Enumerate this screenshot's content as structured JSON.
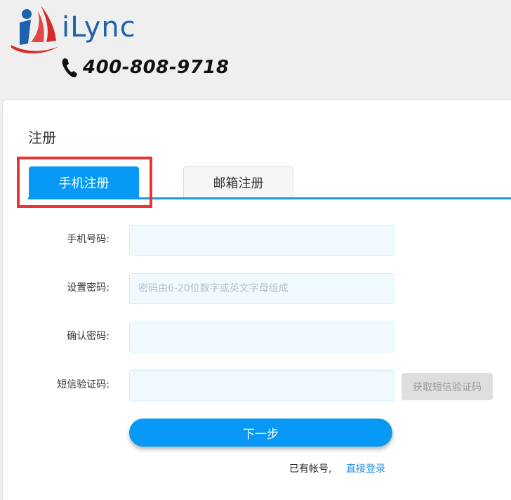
{
  "header": {
    "brand": "iLync",
    "phone": "400-808-9718"
  },
  "page": {
    "title": "注册"
  },
  "tabs": [
    {
      "label": "手机注册",
      "active": true
    },
    {
      "label": "邮箱注册",
      "active": false
    }
  ],
  "form": {
    "phone_label": "手机号码:",
    "password_label": "设置密码:",
    "password_placeholder": "密码由6-20位数字或英文字母组成",
    "confirm_label": "确认密码:",
    "sms_label": "短信验证码:",
    "sms_button": "获取短信验证码",
    "next_button": "下一步"
  },
  "footer": {
    "has_account": "已有帐号,",
    "login_link": "直接登录"
  },
  "colors": {
    "accent": "#0799f5",
    "brand": "#1d62ad",
    "highlight": "#ec3333",
    "input_bg": "#eff9fe"
  }
}
